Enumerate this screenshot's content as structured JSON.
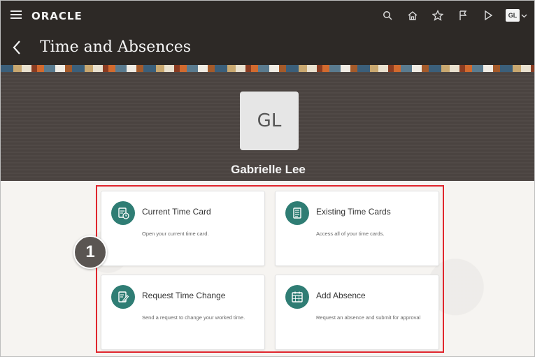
{
  "header": {
    "brand": "ORACLE",
    "avatar_initials": "GL",
    "icons": [
      "menu-icon",
      "search-icon",
      "home-icon",
      "star-icon",
      "flag-icon",
      "play-icon",
      "chevron-down-icon"
    ]
  },
  "page": {
    "title": "Time and Absences"
  },
  "profile": {
    "initials": "GL",
    "name": "Gabrielle Lee"
  },
  "tiles": [
    {
      "title": "Current Time Card",
      "description": "Open your current time card.",
      "icon": "time-card-clock-icon"
    },
    {
      "title": "Existing Time Cards",
      "description": "Access all of your time cards.",
      "icon": "time-cards-list-icon"
    },
    {
      "title": "Request Time Change",
      "description": "Send a request to change your worked time.",
      "icon": "edit-document-icon"
    },
    {
      "title": "Add Absence",
      "description": "Request an absence and submit for approval",
      "icon": "calendar-icon"
    }
  ],
  "callout": {
    "number": "1"
  },
  "colors": {
    "header_bg": "#2d2926",
    "hero_bg": "#4a4340",
    "tile_icon_bg": "#2f7d74",
    "highlight_border": "#e0262d",
    "callout_bg": "#5a5552"
  }
}
